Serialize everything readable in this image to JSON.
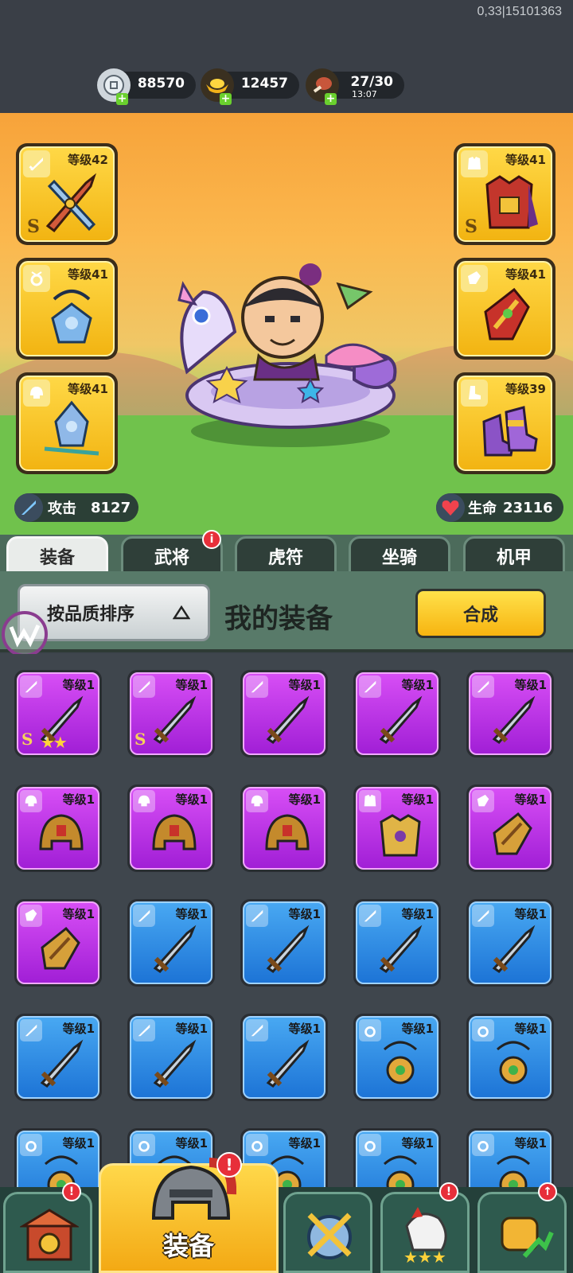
{
  "status": {
    "coord": "0,33|15101363"
  },
  "resources": {
    "silver": {
      "value": "88570",
      "icon": "silver-coin-icon"
    },
    "gold": {
      "value": "12457",
      "icon": "gold-ingot-icon"
    },
    "stamina": {
      "value": "27/30",
      "timer": "13:07",
      "icon": "meat-icon"
    },
    "plus": "+"
  },
  "hero": {
    "left_slots": [
      {
        "level": "等级42",
        "grade": "S",
        "slot_icon": "sword-icon"
      },
      {
        "level": "等级41",
        "grade": "",
        "slot_icon": "necklace-icon"
      },
      {
        "level": "等级41",
        "grade": "",
        "slot_icon": "helmet-icon"
      }
    ],
    "right_slots": [
      {
        "level": "等级41",
        "grade": "S",
        "slot_icon": "armor-icon"
      },
      {
        "level": "等级41",
        "grade": "",
        "slot_icon": "bracer-icon"
      },
      {
        "level": "等级39",
        "grade": "",
        "slot_icon": "boot-icon"
      }
    ],
    "attack": {
      "label": "攻击",
      "value": "8127"
    },
    "life": {
      "label": "生命",
      "value": "23116"
    }
  },
  "tabs": [
    {
      "label": "装备",
      "active": true
    },
    {
      "label": "武将",
      "badge": "i"
    },
    {
      "label": "虎符"
    },
    {
      "label": "坐骑"
    },
    {
      "label": "机甲"
    }
  ],
  "toolbar": {
    "sort_label": "按品质排序",
    "title": "我的装备",
    "synth_label": "合成"
  },
  "items": [
    {
      "level": "等级1",
      "rarity": "purple",
      "type": "sword",
      "grade": "S",
      "stars": "★★"
    },
    {
      "level": "等级1",
      "rarity": "purple",
      "type": "sword",
      "grade": "S"
    },
    {
      "level": "等级1",
      "rarity": "purple",
      "type": "sword"
    },
    {
      "level": "等级1",
      "rarity": "purple",
      "type": "sword"
    },
    {
      "level": "等级1",
      "rarity": "purple",
      "type": "sword"
    },
    {
      "level": "等级1",
      "rarity": "purple",
      "type": "helmet"
    },
    {
      "level": "等级1",
      "rarity": "purple",
      "type": "helmet"
    },
    {
      "level": "等级1",
      "rarity": "purple",
      "type": "helmet"
    },
    {
      "level": "等级1",
      "rarity": "purple",
      "type": "armor"
    },
    {
      "level": "等级1",
      "rarity": "purple",
      "type": "bracer"
    },
    {
      "level": "等级1",
      "rarity": "purple",
      "type": "bracer"
    },
    {
      "level": "等级1",
      "rarity": "blue",
      "type": "sword"
    },
    {
      "level": "等级1",
      "rarity": "blue",
      "type": "sword"
    },
    {
      "level": "等级1",
      "rarity": "blue",
      "type": "sword"
    },
    {
      "level": "等级1",
      "rarity": "blue",
      "type": "sword"
    },
    {
      "level": "等级1",
      "rarity": "blue",
      "type": "sword"
    },
    {
      "level": "等级1",
      "rarity": "blue",
      "type": "sword"
    },
    {
      "level": "等级1",
      "rarity": "blue",
      "type": "sword"
    },
    {
      "level": "等级1",
      "rarity": "blue",
      "type": "necklace"
    },
    {
      "level": "等级1",
      "rarity": "blue",
      "type": "necklace"
    },
    {
      "level": "等级1",
      "rarity": "blue",
      "type": "necklace"
    },
    {
      "level": "等级1",
      "rarity": "blue",
      "type": "necklace"
    },
    {
      "level": "等级1",
      "rarity": "blue",
      "type": "necklace"
    },
    {
      "level": "等级1",
      "rarity": "blue",
      "type": "necklace"
    },
    {
      "level": "等级1",
      "rarity": "blue",
      "type": "necklace"
    }
  ],
  "bottom_nav": [
    {
      "icon": "gate-icon",
      "badge": "!"
    },
    {
      "label": "装备",
      "icon": "helmet-icon",
      "badge": "!",
      "active": true
    },
    {
      "icon": "crossed-swords-icon"
    },
    {
      "icon": "rooster-icon",
      "badge": "!"
    },
    {
      "icon": "fist-upgrade-icon",
      "badge": "↑"
    }
  ],
  "colors": {
    "purple_rarity": "#b52fe2",
    "blue_rarity": "#2f8ce6",
    "gold_slot": "#f8c62a",
    "accent_green": "#587a69",
    "badge_red": "#e72f3a"
  }
}
